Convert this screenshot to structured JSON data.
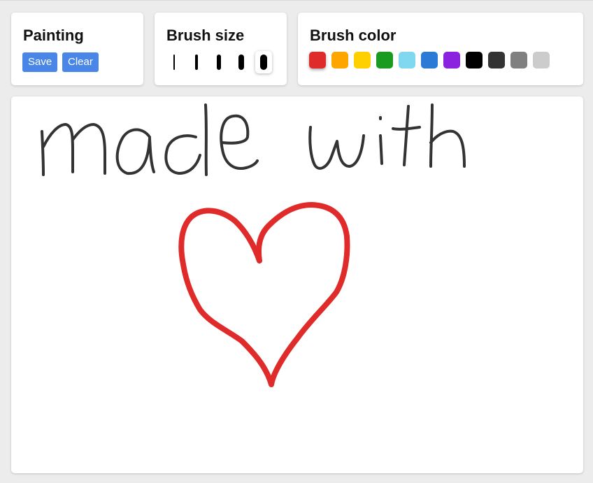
{
  "painting": {
    "title": "Painting",
    "save_label": "Save",
    "clear_label": "Clear",
    "button_color": "#4a86e8"
  },
  "brush_size": {
    "title": "Brush size",
    "sizes": [
      2,
      4,
      6,
      8,
      10
    ],
    "selected_index": 4
  },
  "brush_color": {
    "title": "Brush color",
    "colors": [
      "#e02b2b",
      "#ffa500",
      "#ffd000",
      "#189b1e",
      "#7fd8f0",
      "#2b7ad6",
      "#8b22e0",
      "#000000",
      "#333333",
      "#808080",
      "#cccccc"
    ],
    "selected_index": 0
  },
  "canvas": {
    "stroke_colors": {
      "text": "#333333",
      "heart": "#e02b2b"
    }
  }
}
